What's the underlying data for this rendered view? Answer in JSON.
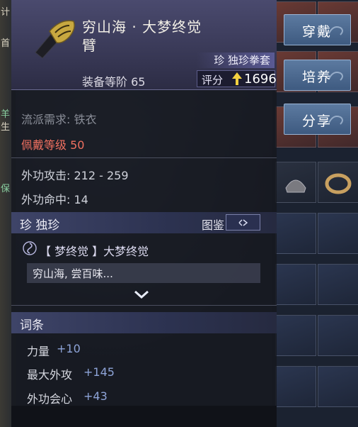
{
  "background": {
    "left_text": [
      "计",
      "首",
      "羊",
      "生",
      "保"
    ]
  },
  "item": {
    "name_line1": "穷山海 · 大梦终觉",
    "name_line2": "臂",
    "grade_label": "珍 独珍拳套",
    "equip_level": "装备等阶 65",
    "score_label": "评分",
    "score_value": "1696"
  },
  "requirements": {
    "school": "流派需求: 铁衣",
    "wear_level_label": "佩戴等级",
    "wear_level_value": "50"
  },
  "stats": {
    "attack": "外功攻击: 212 - 259",
    "hit": "外功命中: 14"
  },
  "rarity_section": {
    "label": "珍  独珍",
    "tujian": "图鉴",
    "set_name": "【 梦终觉 】大梦终觉",
    "flavor": "穷山海, 尝百味..."
  },
  "affix_section": {
    "label": "词条",
    "items": [
      {
        "name": "力量",
        "value": "+10"
      },
      {
        "name": "最大外攻",
        "value": "+145"
      },
      {
        "name": "外功会心",
        "value": "+43"
      }
    ]
  },
  "actions": {
    "equip": "穿戴",
    "train": "培养",
    "share": "分享"
  },
  "colors": {
    "red_requirement": "#f07060",
    "affix_value": "#8ea4d8",
    "score_arrow": "#f2d040",
    "button": "#4e6c92"
  }
}
